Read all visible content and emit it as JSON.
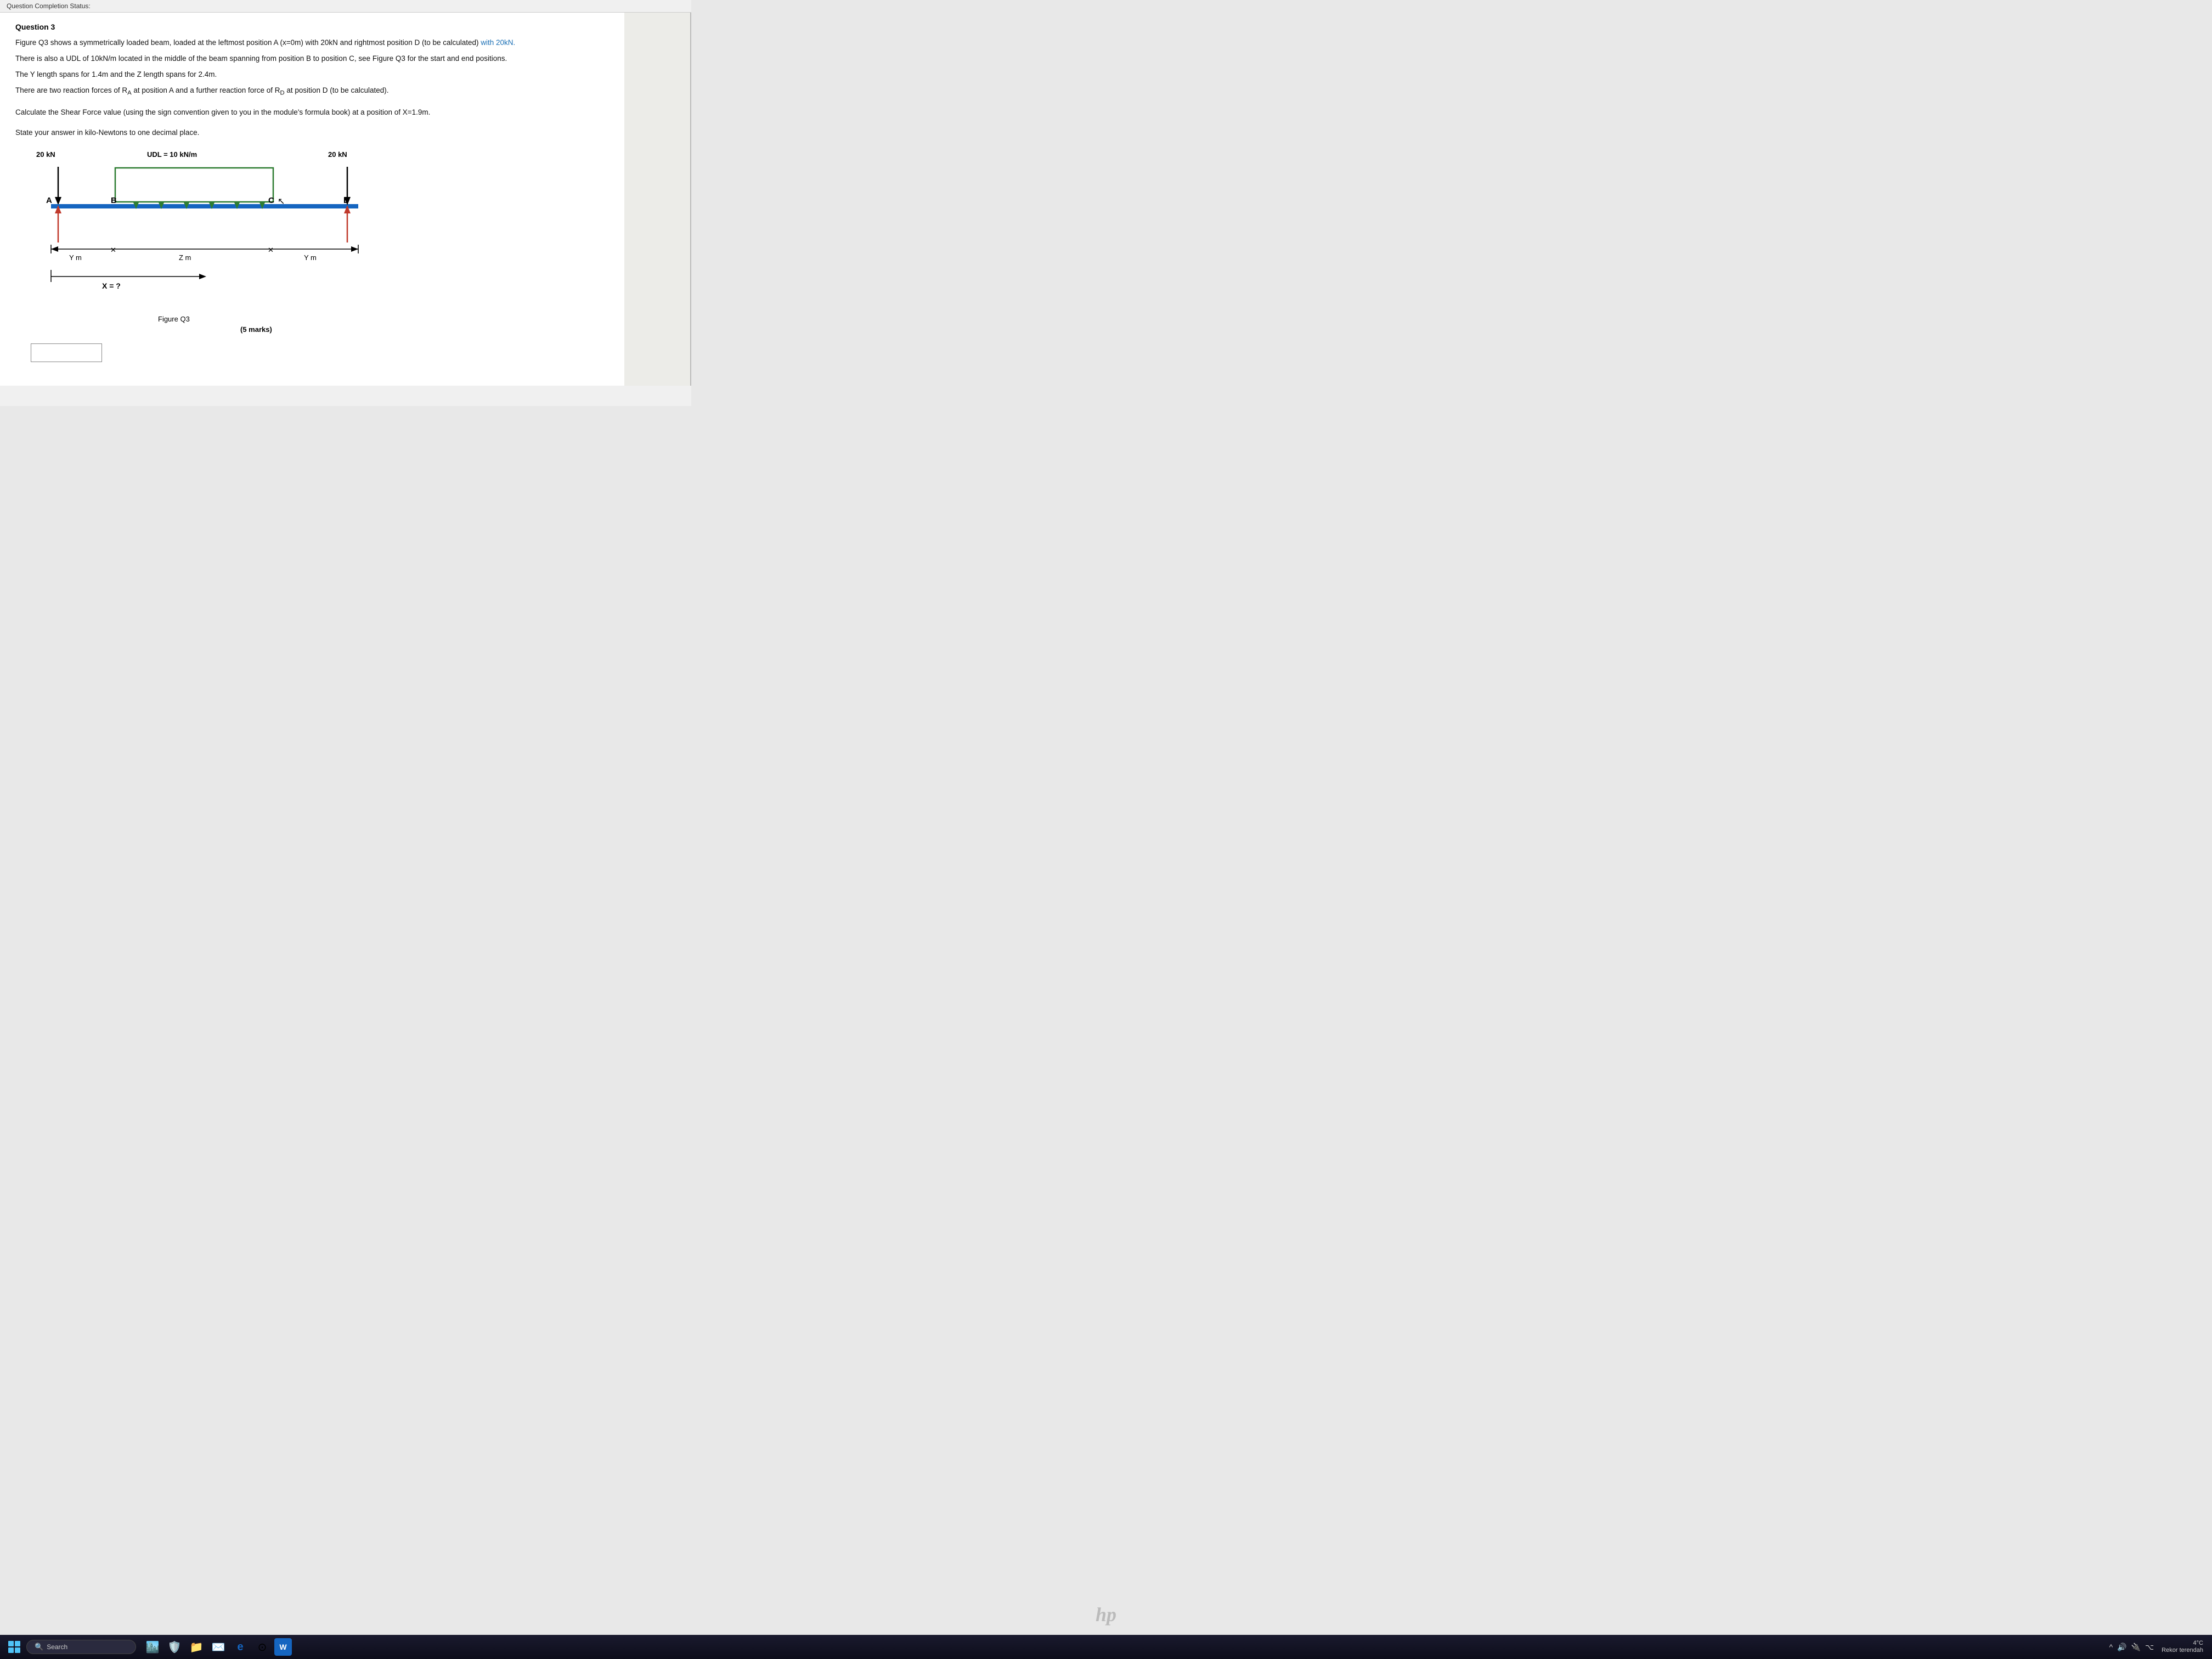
{
  "status_bar": {
    "label": "Question Completion Status:"
  },
  "question": {
    "number": "Question 3",
    "paragraph1": "Figure Q3 shows a symmetrically loaded beam, loaded at the leftmost position A (x=0m) with 20kN and rightmost position D (to be calculated) with 20kN.",
    "paragraph1_highlight": "with 20kN.",
    "paragraph2": "There is also a UDL of 10kN/m located in the middle of the beam spanning from position B to position C, see Figure Q3 for the start and end positions.",
    "paragraph3": "The Y length spans for 1.4m and the Z length spans for 2.4m.",
    "paragraph4": "There are two reaction forces of R",
    "paragraph4_sub_A": "A",
    "paragraph4_cont": " at position A and a further reaction force of R",
    "paragraph4_sub_D": "D",
    "paragraph4_end": " at position D (to be calculated).",
    "instruction1": "Calculate the Shear Force value (using the sign convention given to you in the module's formula book) at a position of X=1.9m.",
    "instruction2": "State your answer in kilo-Newtons to one decimal place.",
    "diagram": {
      "force_left_label": "20 kN",
      "udl_label": "UDL = 10 kN/m",
      "force_right_label": "20 kN",
      "label_A": "A",
      "label_B": "B",
      "label_C": "C",
      "label_D": "D",
      "dim_left": "Y m",
      "dim_center": "Z m",
      "dim_right": "Y m",
      "x_label": "X = ?",
      "figure_caption": "Figure Q3",
      "marks": "(5 marks)"
    }
  },
  "taskbar": {
    "search_placeholder": "Search",
    "temperature": "4°C",
    "temperature_sub": "Rekor terendah"
  }
}
